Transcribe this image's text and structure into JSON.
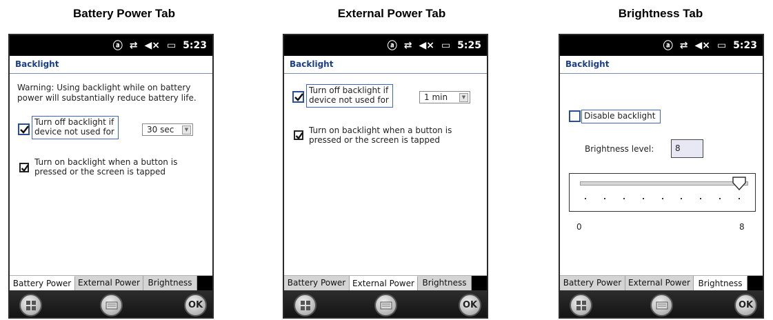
{
  "captions": [
    "Battery Power Tab",
    "External Power Tab",
    "Brightness Tab"
  ],
  "screens": [
    {
      "status_time": "5:23",
      "title": "Backlight",
      "warning_line1": "Warning: Using backlight while on battery",
      "warning_line2": "power will substantially reduce battery life.",
      "turnoff_line1": "Turn off backlight if",
      "turnoff_line2": "device not used for",
      "dropdown_value": "30 sec",
      "turnon_line1": "Turn on backlight when a button is",
      "turnon_line2": "pressed or the screen is tapped",
      "tabs": [
        "Battery Power",
        "External Power",
        "Brightness"
      ],
      "active_tab": "Battery Power"
    },
    {
      "status_time": "5:25",
      "title": "Backlight",
      "turnoff_line1": "Turn off backlight if",
      "turnoff_line2": "device not used for",
      "dropdown_value": "1 min",
      "turnon_line1": "Turn on backlight when a button is",
      "turnon_line2": "pressed or the screen is tapped",
      "tabs": [
        "Battery Power",
        "External Power",
        "Brightness"
      ],
      "active_tab": "External Power"
    },
    {
      "status_time": "5:23",
      "title": "Backlight",
      "disable_label": "Disable backlight",
      "brightness_label": "Brightness level:",
      "brightness_value": "8",
      "slider_min": "0",
      "slider_max": "8",
      "slider_level": 8,
      "tabs": [
        "Battery Power",
        "External Power",
        "Brightness"
      ],
      "active_tab": "Brightness"
    }
  ],
  "status_icons": [
    "a-icon",
    "sync-arrows-icon",
    "speaker-muted-icon",
    "battery-charging-icon"
  ],
  "softkeys": {
    "ok_label": "OK"
  },
  "colors": {
    "title_blue": "#1c3f8a",
    "focus_blue": "#3b62c4"
  }
}
